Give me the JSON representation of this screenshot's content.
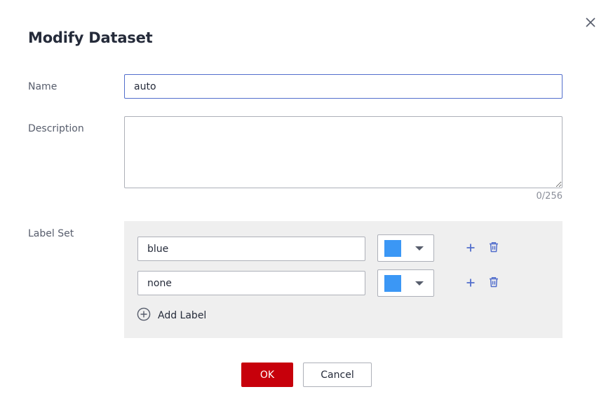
{
  "dialog": {
    "title": "Modify Dataset",
    "close_icon": "close-icon"
  },
  "form": {
    "name": {
      "label": "Name",
      "value": "auto"
    },
    "description": {
      "label": "Description",
      "value": "",
      "counter": "0/256"
    },
    "label_set": {
      "label": "Label Set",
      "labels": [
        {
          "name": "blue",
          "color": "#3b97f5"
        },
        {
          "name": "none",
          "color": "#3b97f5"
        }
      ],
      "add_label": "Add Label",
      "icons": {
        "add": "plus-icon",
        "delete": "trash-icon",
        "add_label": "plus-circle-icon",
        "dropdown": "caret-down-icon"
      }
    }
  },
  "footer": {
    "ok_label": "OK",
    "cancel_label": "Cancel"
  },
  "colors": {
    "primary": "#c7000b",
    "accent_blue": "#526ecc",
    "panel_bg": "#efefef"
  }
}
